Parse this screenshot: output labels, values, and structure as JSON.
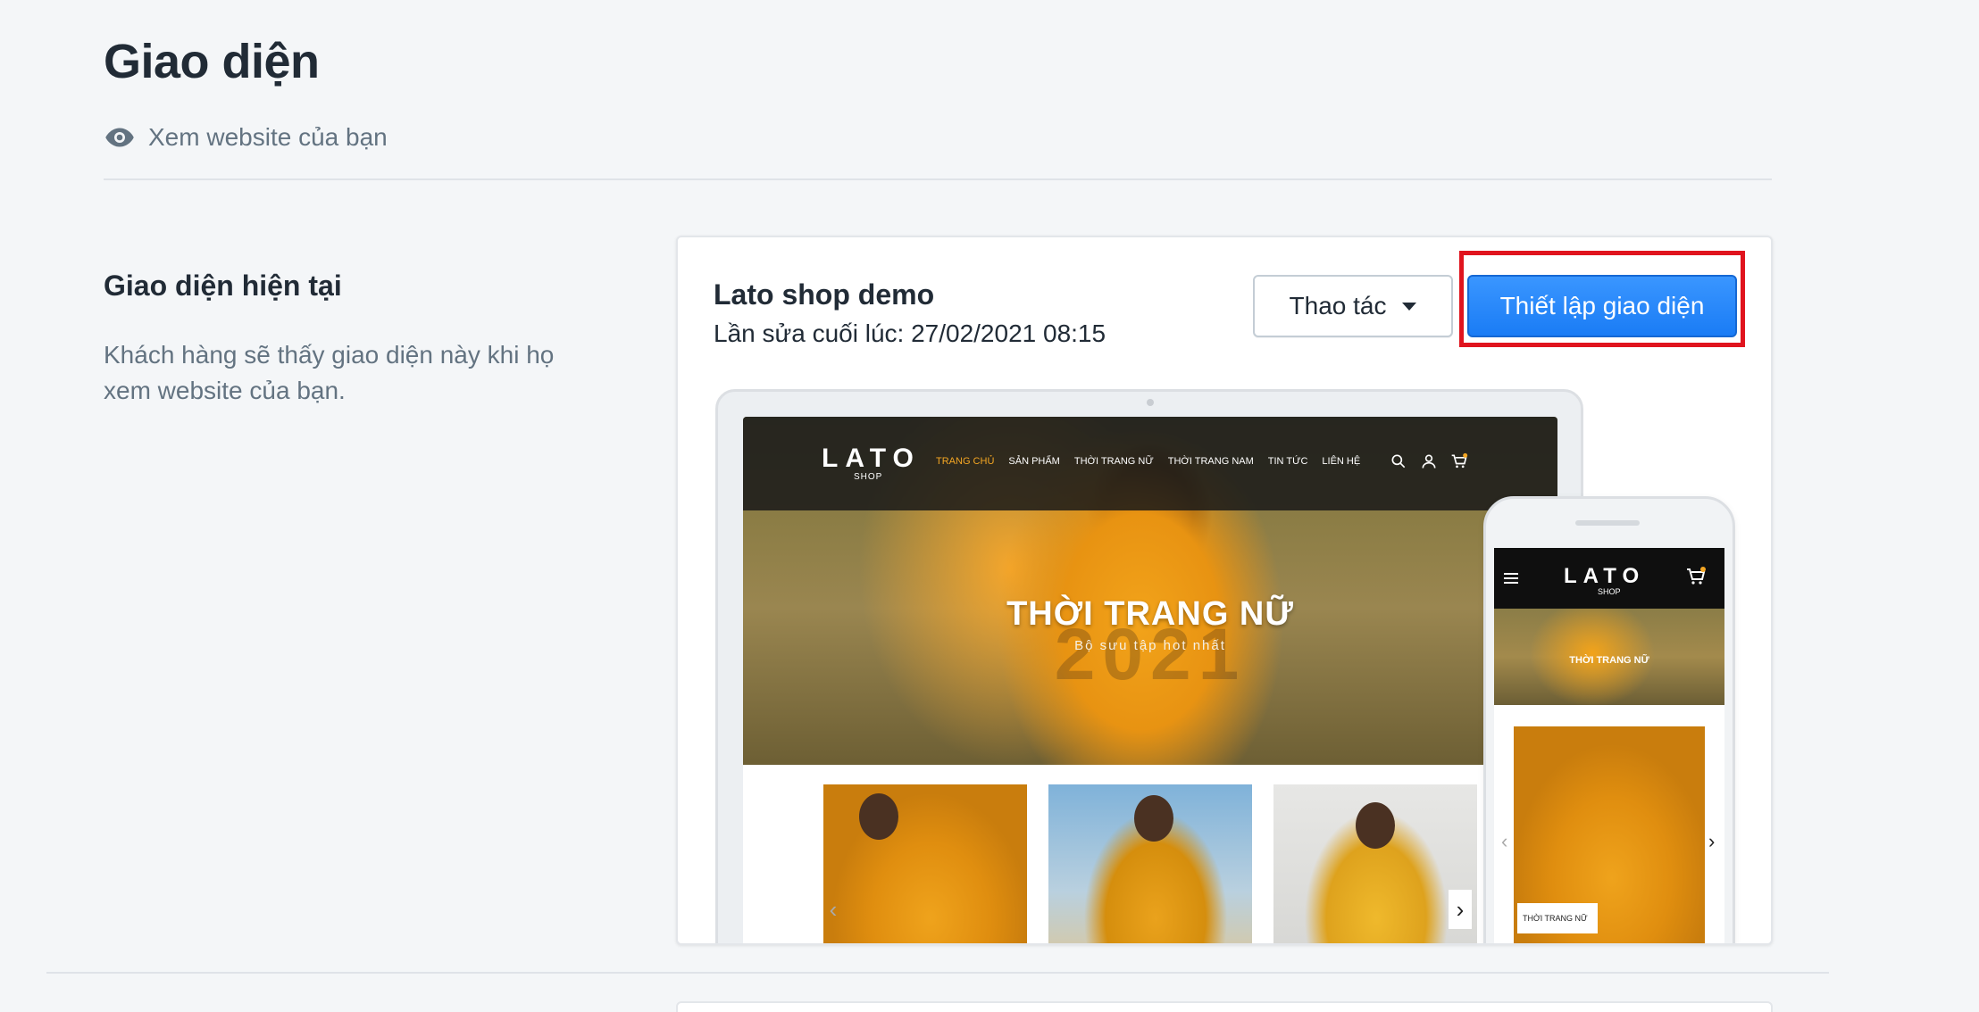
{
  "header": {
    "title": "Giao diện",
    "view_site_label": "Xem website của bạn"
  },
  "current_theme": {
    "section_title": "Giao diện hiện tại",
    "section_desc": "Khách hàng sẽ thấy giao diện này khi họ xem website của bạn.",
    "theme_name": "Lato shop demo",
    "last_updated": "Lần sửa cuối lúc: 27/02/2021 08:15",
    "actions_label": "Thao tác",
    "setup_label": "Thiết lập giao diện"
  },
  "preview": {
    "logo": "LATO",
    "logo_sub": "SHOP",
    "menu": [
      "TRANG CHỦ",
      "SẢN PHẨM",
      "THỜI TRANG NỮ",
      "THỜI TRANG NAM",
      "TIN TỨC",
      "LIÊN HỆ"
    ],
    "hero_title": "THỜI TRANG NỮ",
    "hero_subtitle": "Bộ sưu tập hot nhất",
    "hero_year": "2021",
    "mobile_hero_title": "THỜI TRANG NỮ",
    "mobile_tag": "THỜI TRANG NỮ"
  },
  "colors": {
    "primary": "#1a7cf5",
    "highlight": "#e0141e",
    "accent": "#f4a623"
  }
}
